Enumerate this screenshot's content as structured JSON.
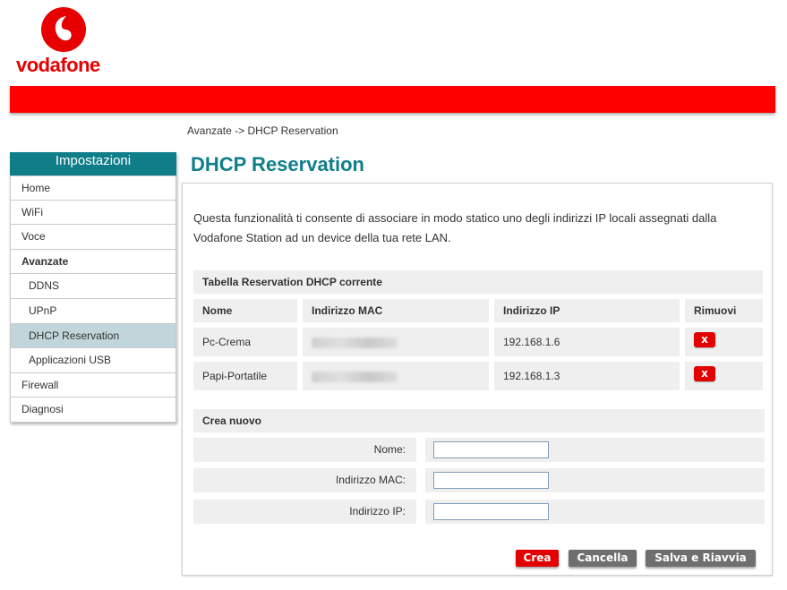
{
  "brand": {
    "logo_text": "vodafone",
    "accent_color": "#e60000",
    "teal_color": "#0f7e89"
  },
  "breadcrumb": "Avanzate -> DHCP Reservation",
  "sidebar": {
    "title": "Impostazioni",
    "items": [
      {
        "label": "Home"
      },
      {
        "label": "WiFi"
      },
      {
        "label": "Voce"
      },
      {
        "label": "Avanzate"
      },
      {
        "label": "DDNS"
      },
      {
        "label": "UPnP"
      },
      {
        "label": "DHCP Reservation"
      },
      {
        "label": "Applicazioni USB"
      },
      {
        "label": "Firewall"
      },
      {
        "label": "Diagnosi"
      }
    ]
  },
  "page": {
    "title": "DHCP Reservation",
    "intro": "Questa funzionalità ti consente di associare in modo statico uno degli indirizzi IP locali assegnati dalla Vodafone Station ad un device della tua rete LAN."
  },
  "table": {
    "title": "Tabella Reservation DHCP corrente",
    "columns": [
      "Nome",
      "Indirizzo MAC",
      "Indirizzo IP",
      "Rimuovi"
    ],
    "rows": [
      {
        "name": "Pc-Crema",
        "ip": "192.168.1.6"
      },
      {
        "name": "Papi-Portatile",
        "ip": "192.168.1.3"
      }
    ],
    "remove_icon": "x-icon",
    "remove_label": "x"
  },
  "create": {
    "title": "Crea nuovo",
    "fields": [
      {
        "label": "Nome:",
        "value": ""
      },
      {
        "label": "Indirizzo MAC:",
        "value": ""
      },
      {
        "label": "Indirizzo IP:",
        "value": ""
      }
    ]
  },
  "buttons": {
    "create": "Crea",
    "cancel": "Cancella",
    "save": "Salva e Riavvia"
  }
}
